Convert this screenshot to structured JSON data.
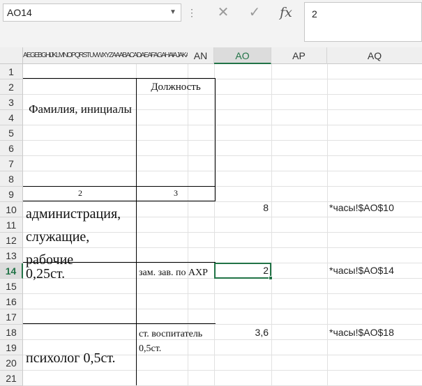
{
  "name_box": "AO14",
  "formula_bar": {
    "value": "2",
    "cancel_glyph": "✕",
    "enter_glyph": "✓",
    "fx_glyph": "fx"
  },
  "columns": {
    "compressed_labels": "AEGEBGHIJKLMNOPQRSTUVWXYZAAABACADAEAFAGAHAIAJAKAL",
    "AN": "AN",
    "AO": "AO",
    "AP": "AP",
    "AQ": "AQ"
  },
  "rows": [
    "1",
    "2",
    "3",
    "4",
    "5",
    "6",
    "7",
    "8",
    "9",
    "10",
    "11",
    "12",
    "13",
    "14",
    "15",
    "16",
    "17",
    "18",
    "19",
    "20",
    "21"
  ],
  "header_table": {
    "name_header": "Фамилия, инициалы",
    "position_header": "Должность",
    "name_index": "2",
    "position_index": "3"
  },
  "data_rows": [
    {
      "name": "администрация, служащие, рабочие",
      "position": "",
      "value": "8",
      "ref": "*часы!$AO$10"
    },
    {
      "name": "0,25ст.",
      "position": "зам. зав. по АХР",
      "value": "2",
      "ref": "*часы!$AO$14"
    },
    {
      "name": "психолог 0,5ст.",
      "position": "ст. воспитатель 0,5ст.",
      "value": "3,6",
      "ref": "*часы!$AO$18"
    }
  ],
  "colors": {
    "accent": "#217346",
    "header_bg": "#efefef",
    "toolbar_bg": "#f3f3f3"
  }
}
